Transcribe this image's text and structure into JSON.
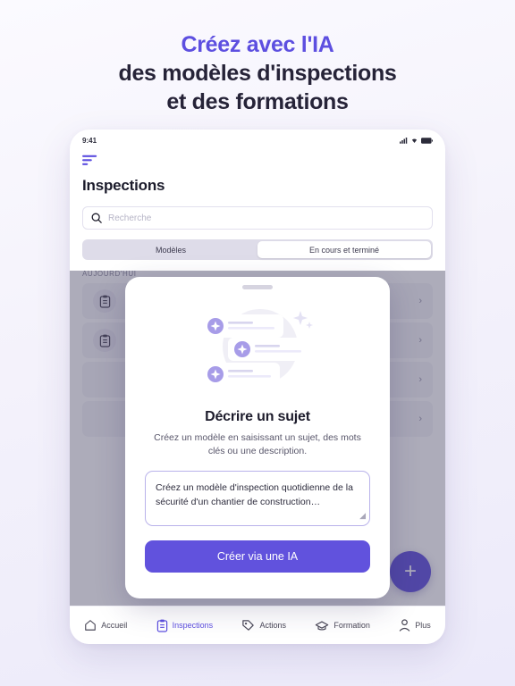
{
  "headline": {
    "line1": "Créez avec l'IA",
    "line2": "des modèles d'inspections",
    "line3": "et des formations",
    "accent_color": "#5d4fe0",
    "text_color": "#262338",
    "sparkle_icon": "sparkle-icon"
  },
  "device": {
    "status_bar": {
      "time": "9:41",
      "icons": [
        "signal-icon",
        "wifi-icon",
        "battery-icon"
      ]
    },
    "app": {
      "menu_icon": "hamburger-menu-icon",
      "title": "Inspections",
      "search": {
        "placeholder": "Recherche",
        "icon": "search-icon"
      },
      "segmented": {
        "options": [
          "Modèles",
          "En cours et terminé"
        ],
        "selected": "En cours et terminé"
      },
      "list": {
        "day_label": "AUJOURD'HUI",
        "rows": [
          {
            "icon": "clipboard-icon",
            "chevron": "chevron-right-icon"
          },
          {
            "icon": "clipboard-icon",
            "chevron": "chevron-right-icon"
          },
          {
            "icon": "",
            "chevron": "chevron-right-icon"
          },
          {
            "icon": "",
            "chevron": "chevron-right-icon"
          }
        ]
      },
      "fab": {
        "label": "+",
        "icon": "plus-icon",
        "color": "#6152dd"
      },
      "bottom_nav": [
        {
          "label": "Accueil",
          "icon": "home-icon",
          "active": false
        },
        {
          "label": "Inspections",
          "icon": "clipboard-icon",
          "active": true
        },
        {
          "label": "Actions",
          "icon": "tag-icon",
          "active": false
        },
        {
          "label": "Formation",
          "icon": "graduation-cap-icon",
          "active": false
        },
        {
          "label": "Plus",
          "icon": "person-icon",
          "active": false
        }
      ]
    }
  },
  "modal": {
    "handle": "drag-handle",
    "illustration": "ai-cards-illustration",
    "title": "Décrire un sujet",
    "subtitle": "Créez un modèle en saisissant un sujet, des mots clés ou une description.",
    "prompt_value": "Créez un modèle d'inspection quotidienne de la sécurité d'un chantier de construction…",
    "cta_label": "Créer via une IA",
    "cta_color": "#6152dd"
  }
}
